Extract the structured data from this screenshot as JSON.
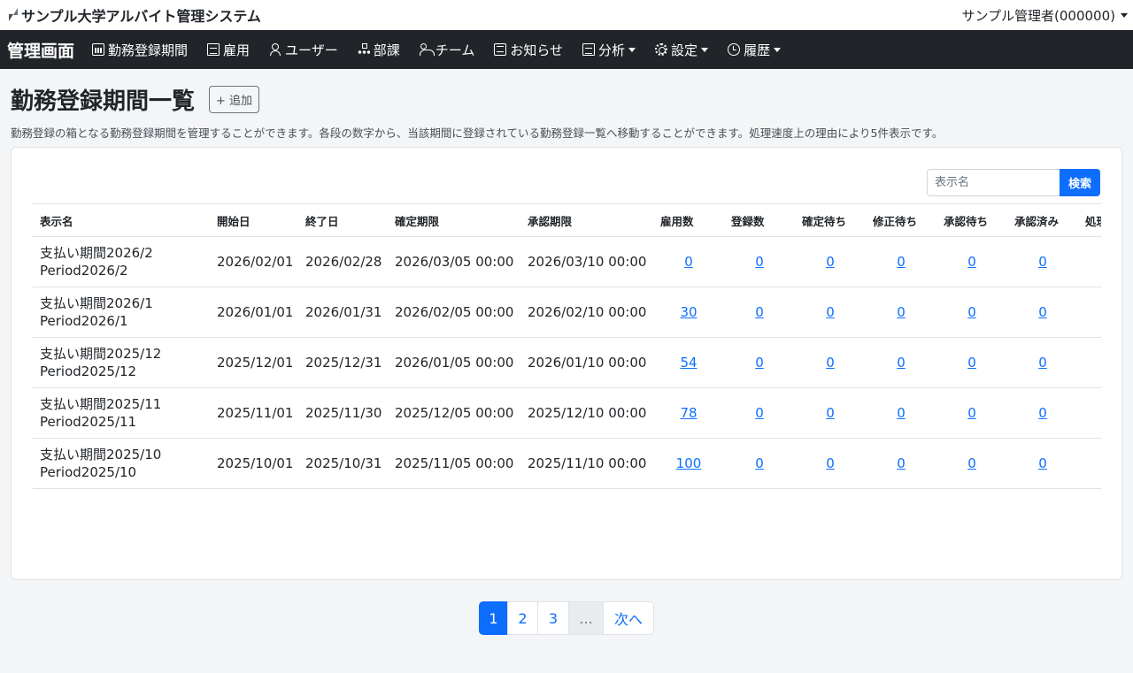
{
  "app": {
    "title": "サンプル大学アルバイト管理システム",
    "account": "サンプル管理者(000000)"
  },
  "nav": {
    "title": "管理画面",
    "items": [
      {
        "label": "勤務登録期間",
        "icon": "calendar-icon"
      },
      {
        "label": "雇用",
        "icon": "document-icon"
      },
      {
        "label": "ユーザー",
        "icon": "user-icon"
      },
      {
        "label": "部課",
        "icon": "org-chart-icon"
      },
      {
        "label": "チーム",
        "icon": "team-icon"
      },
      {
        "label": "お知らせ",
        "icon": "news-icon"
      },
      {
        "label": "分析",
        "icon": "report-icon"
      },
      {
        "label": "設定",
        "icon": "gear-icon"
      },
      {
        "label": "履歴",
        "icon": "clock-icon"
      }
    ]
  },
  "page": {
    "title": "勤務登録期間一覧",
    "add_label": "+ 追加",
    "description": "勤務登録の箱となる勤務登録期間を管理することができます。各段の数字から、当該期間に登録されている勤務登録一覧へ移動することができます。処理速度上の理由により5件表示です。"
  },
  "search": {
    "placeholder": "表示名",
    "button_label": "検索"
  },
  "table": {
    "headers": [
      "表示名",
      "開始日",
      "終了日",
      "確定期限",
      "承認期限",
      "雇用数",
      "登録数",
      "確定待ち",
      "修正待ち",
      "承認待ち",
      "承認済み",
      "処理"
    ],
    "rows": [
      {
        "name1": "支払い期間2026/2",
        "name2": "Period2026/2",
        "start": "2026/02/01",
        "end": "2026/02/28",
        "confirm": "2026/03/05 00:00",
        "approve": "2026/03/10 00:00",
        "emp": "0",
        "reg": "0",
        "pending_confirm": "0",
        "pending_fix": "0",
        "pending_approval": "0",
        "approved": "0"
      },
      {
        "name1": "支払い期間2026/1",
        "name2": "Period2026/1",
        "start": "2026/01/01",
        "end": "2026/01/31",
        "confirm": "2026/02/05 00:00",
        "approve": "2026/02/10 00:00",
        "emp": "30",
        "reg": "0",
        "pending_confirm": "0",
        "pending_fix": "0",
        "pending_approval": "0",
        "approved": "0"
      },
      {
        "name1": "支払い期間2025/12",
        "name2": "Period2025/12",
        "start": "2025/12/01",
        "end": "2025/12/31",
        "confirm": "2026/01/05 00:00",
        "approve": "2026/01/10 00:00",
        "emp": "54",
        "reg": "0",
        "pending_confirm": "0",
        "pending_fix": "0",
        "pending_approval": "0",
        "approved": "0"
      },
      {
        "name1": "支払い期間2025/11",
        "name2": "Period2025/11",
        "start": "2025/11/01",
        "end": "2025/11/30",
        "confirm": "2025/12/05 00:00",
        "approve": "2025/12/10 00:00",
        "emp": "78",
        "reg": "0",
        "pending_confirm": "0",
        "pending_fix": "0",
        "pending_approval": "0",
        "approved": "0"
      },
      {
        "name1": "支払い期間2025/10",
        "name2": "Period2025/10",
        "start": "2025/10/01",
        "end": "2025/10/31",
        "confirm": "2025/11/05 00:00",
        "approve": "2025/11/10 00:00",
        "emp": "100",
        "reg": "0",
        "pending_confirm": "0",
        "pending_fix": "0",
        "pending_approval": "0",
        "approved": "0"
      }
    ]
  },
  "pagination": {
    "pages": [
      "1",
      "2",
      "3"
    ],
    "ellipsis": "...",
    "next": "次へ",
    "current": "1"
  },
  "colors": {
    "primary": "#0d6efd",
    "navbar": "#212529"
  }
}
